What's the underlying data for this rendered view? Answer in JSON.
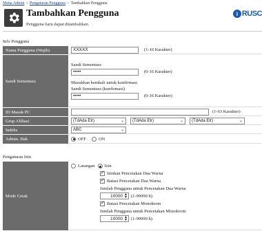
{
  "breadcrumb": {
    "item1": "Mena Admin",
    "item2": "Pengaturan Pengguna",
    "item3": "Tambahkan Pengguna",
    "sep": ">"
  },
  "header": {
    "title": "Tambahkan Pengguna",
    "subtitle": "Pengguna baru dapat ditambahkan.",
    "brand_text": "RUSC",
    "brand_mark": "i"
  },
  "sections": {
    "info": "Info Pengguna",
    "perm": "Pengaturan Izin"
  },
  "form": {
    "username_label": "Nama Pengguna (Wajib)",
    "username_value": "XXXXX",
    "username_hint": "(1-10 Karakter)",
    "password_label": "Sandi Sementara",
    "password_caption": "Sandi Sementara",
    "password_value": "•••••",
    "password_hint": "(0-16 Karakter)",
    "confirm_note": "Masukkan kembali untuk konfirmasi.",
    "confirm_caption": "Sandi Sementara (konfirmasi)",
    "confirm_value": "•••••",
    "confirm_hint": "(0-16 Karakter)",
    "pcid_label": "ID Masuk PC",
    "pcid_value": "",
    "pcid_hint": "(1-63 Karakter)",
    "group_label": "Grup Afiliasi",
    "group_options": [
      "(TdAda Etr)",
      "(TdAda Etr)",
      "(TdAda Etr)"
    ],
    "index_label": "Indeks",
    "index_value": "ABC",
    "admin_label": "Admin. Hak",
    "admin_off": "OFF",
    "admin_on": "ON"
  },
  "perm": {
    "print_label": "Mode Cetak",
    "restrict": "Larangan",
    "allow": "Izin",
    "allow_duo": "Izinkan Pencetakan Dua Warna",
    "limit_duo": "Batasi Pencetakan Dua Warna",
    "duo_count_caption": "Jumlah Pengguna untuk Pencetakan Dua Warna",
    "duo_count_value": "10000",
    "duo_count_hint": "(1-99999 h)",
    "limit_mono": "Batasi Pencetakan Monokrom",
    "mono_count_caption": "Jumlah Pengguna untuk Pencetakan Monokrom",
    "mono_count_value": "10000",
    "mono_count_hint": "(1-99999 h)"
  },
  "icons": {
    "gear": "gear-icon",
    "chevron": "chevron-down-icon",
    "spinner": "spinner-arrows-icon"
  },
  "colors": {
    "label_bg": "#6b6b6b",
    "header_icon_bg": "#3c3c3c",
    "brand": "#1a5aa8",
    "link": "#1a3f8f"
  }
}
